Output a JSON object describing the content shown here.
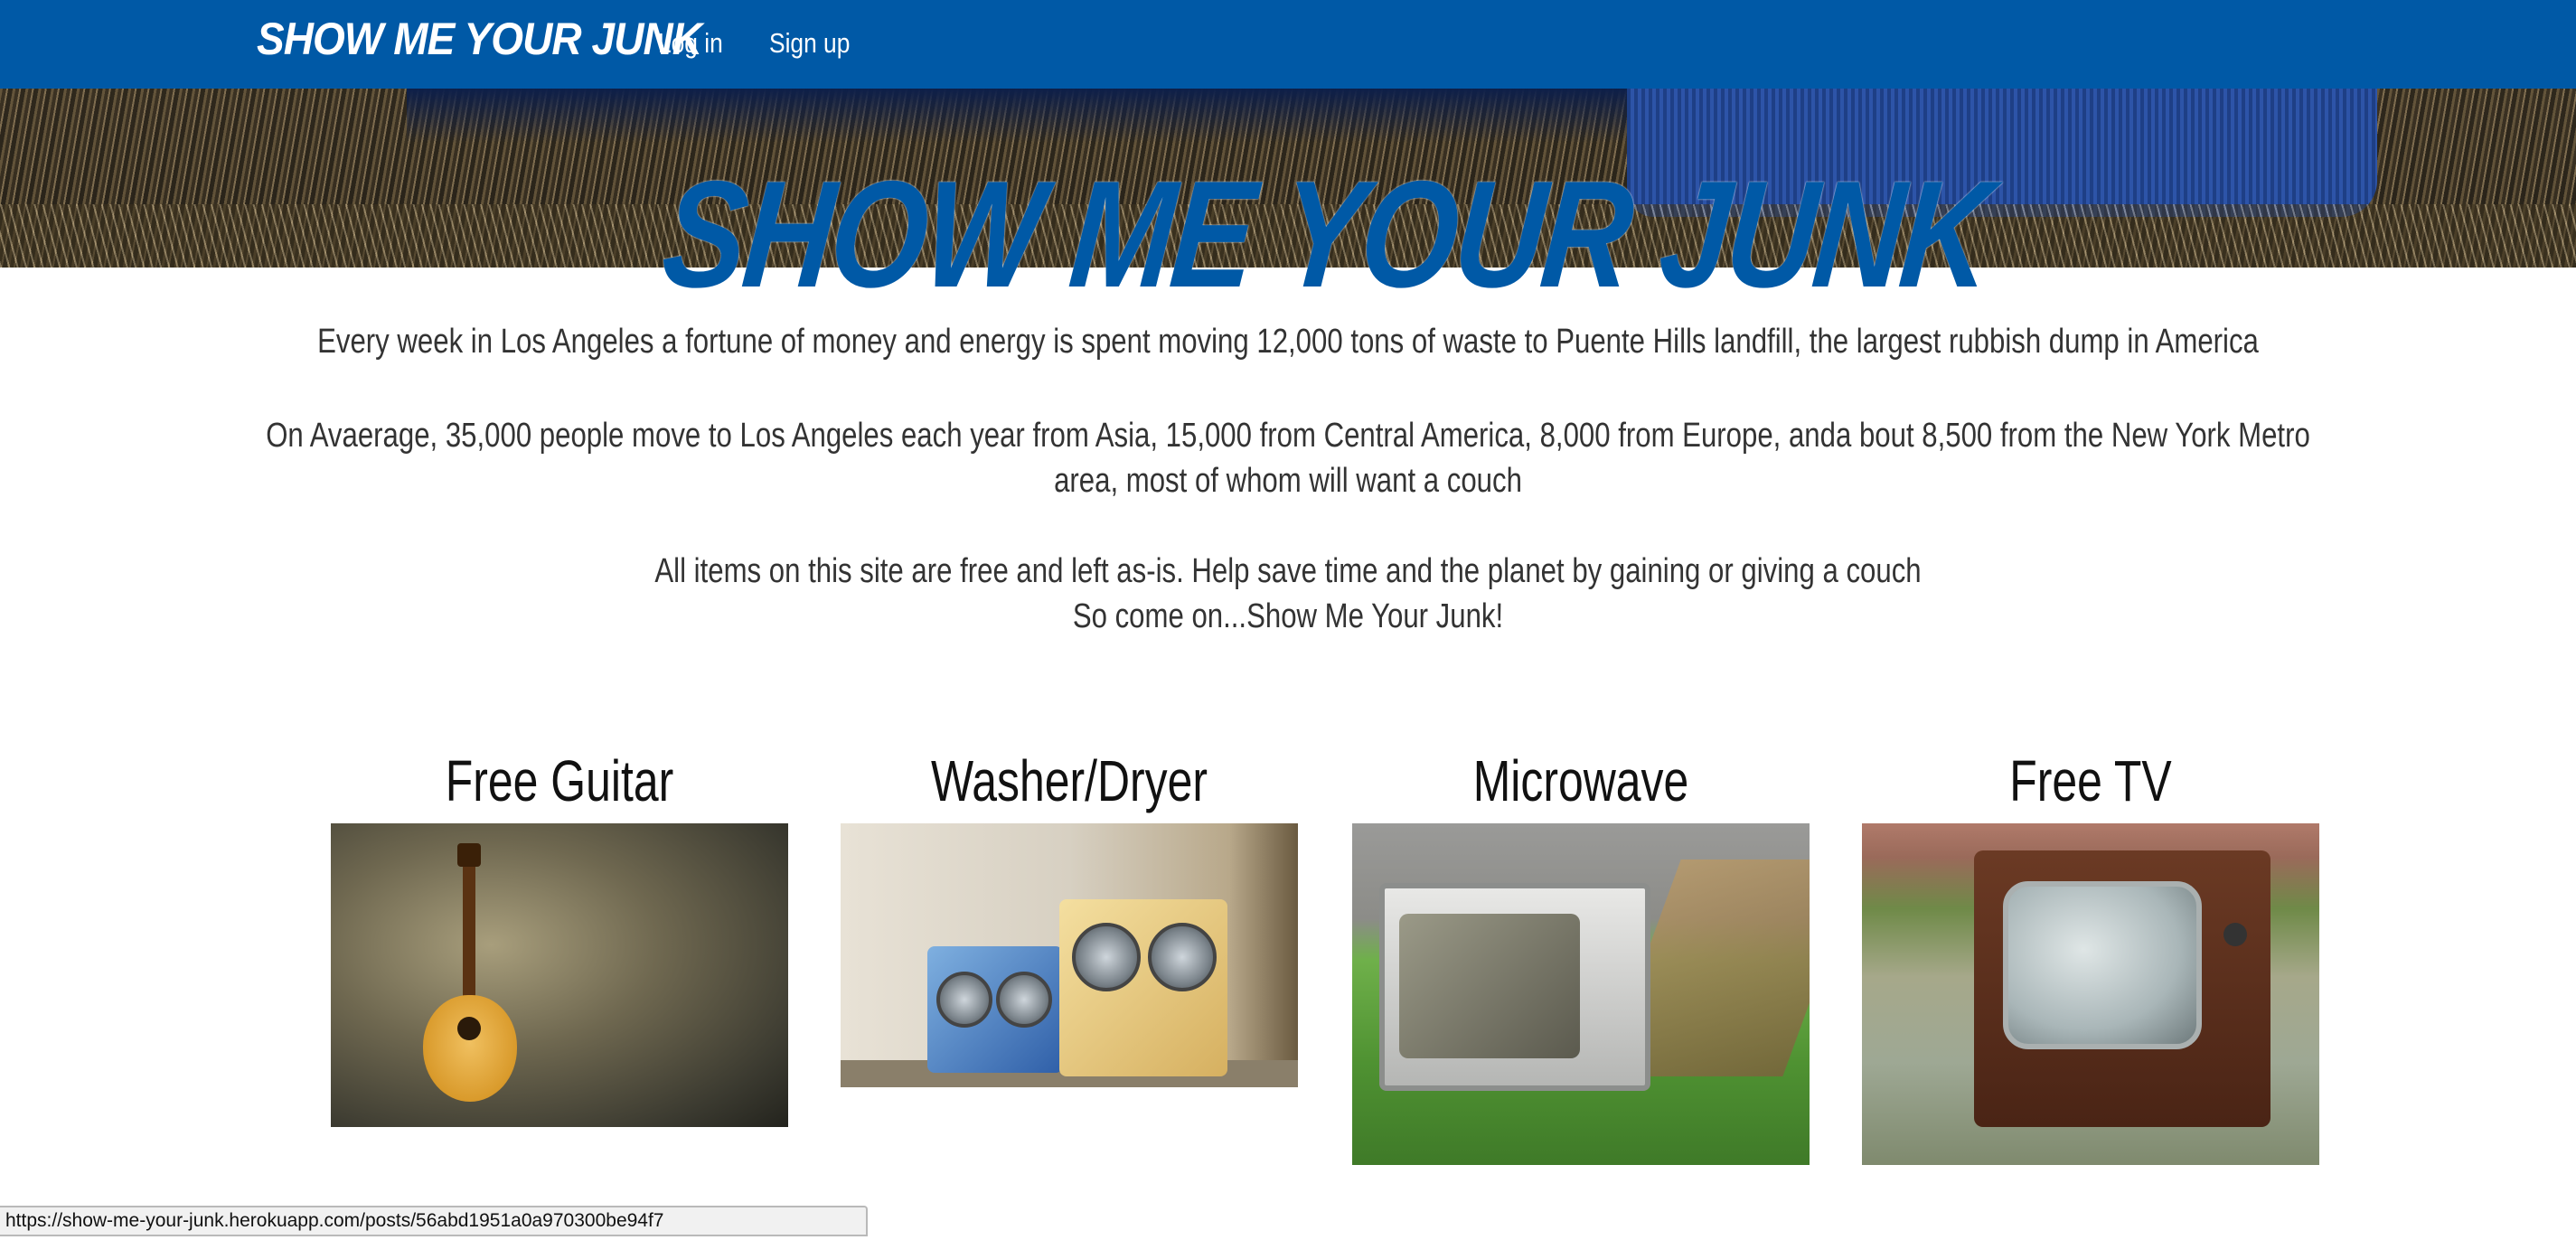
{
  "navbar": {
    "brand": "SHOW ME YOUR JUNK",
    "links": [
      "Log in",
      "Sign up"
    ],
    "background_color": "#0059a6"
  },
  "hero": {
    "title": "SHOW ME YOUR JUNK",
    "title_color": "#0059a6"
  },
  "intro": {
    "p1": "Every week in Los Angeles a fortune of money and energy is spent moving 12,000 tons of waste to Puente Hills landfill, the largest rubbish dump in America",
    "p2_line1": "On Avaerage, 35,000 people move to Los Angeles each year from Asia, 15,000 from Central America, 8,000 from Europe, anda bout 8,500 from the New York Metro",
    "p2_line2": "area, most of whom will want a couch",
    "p3_line1": "All items on this site are free and left as-is. Help save time and the planet by gaining or giving a couch",
    "p3_line2": "So come on...Show Me Your Junk!"
  },
  "posts": [
    {
      "title": "Free Guitar",
      "image": "guitar-photo"
    },
    {
      "title": "Washer/Dryer",
      "image": "washer-dryer-photo"
    },
    {
      "title": "Microwave",
      "image": "microwave-photo"
    },
    {
      "title": "Free TV",
      "image": "tv-photo"
    }
  ],
  "status_bar": {
    "url": "https://show-me-your-junk.herokuapp.com/posts/56abd1951a0a970300be94f7"
  }
}
